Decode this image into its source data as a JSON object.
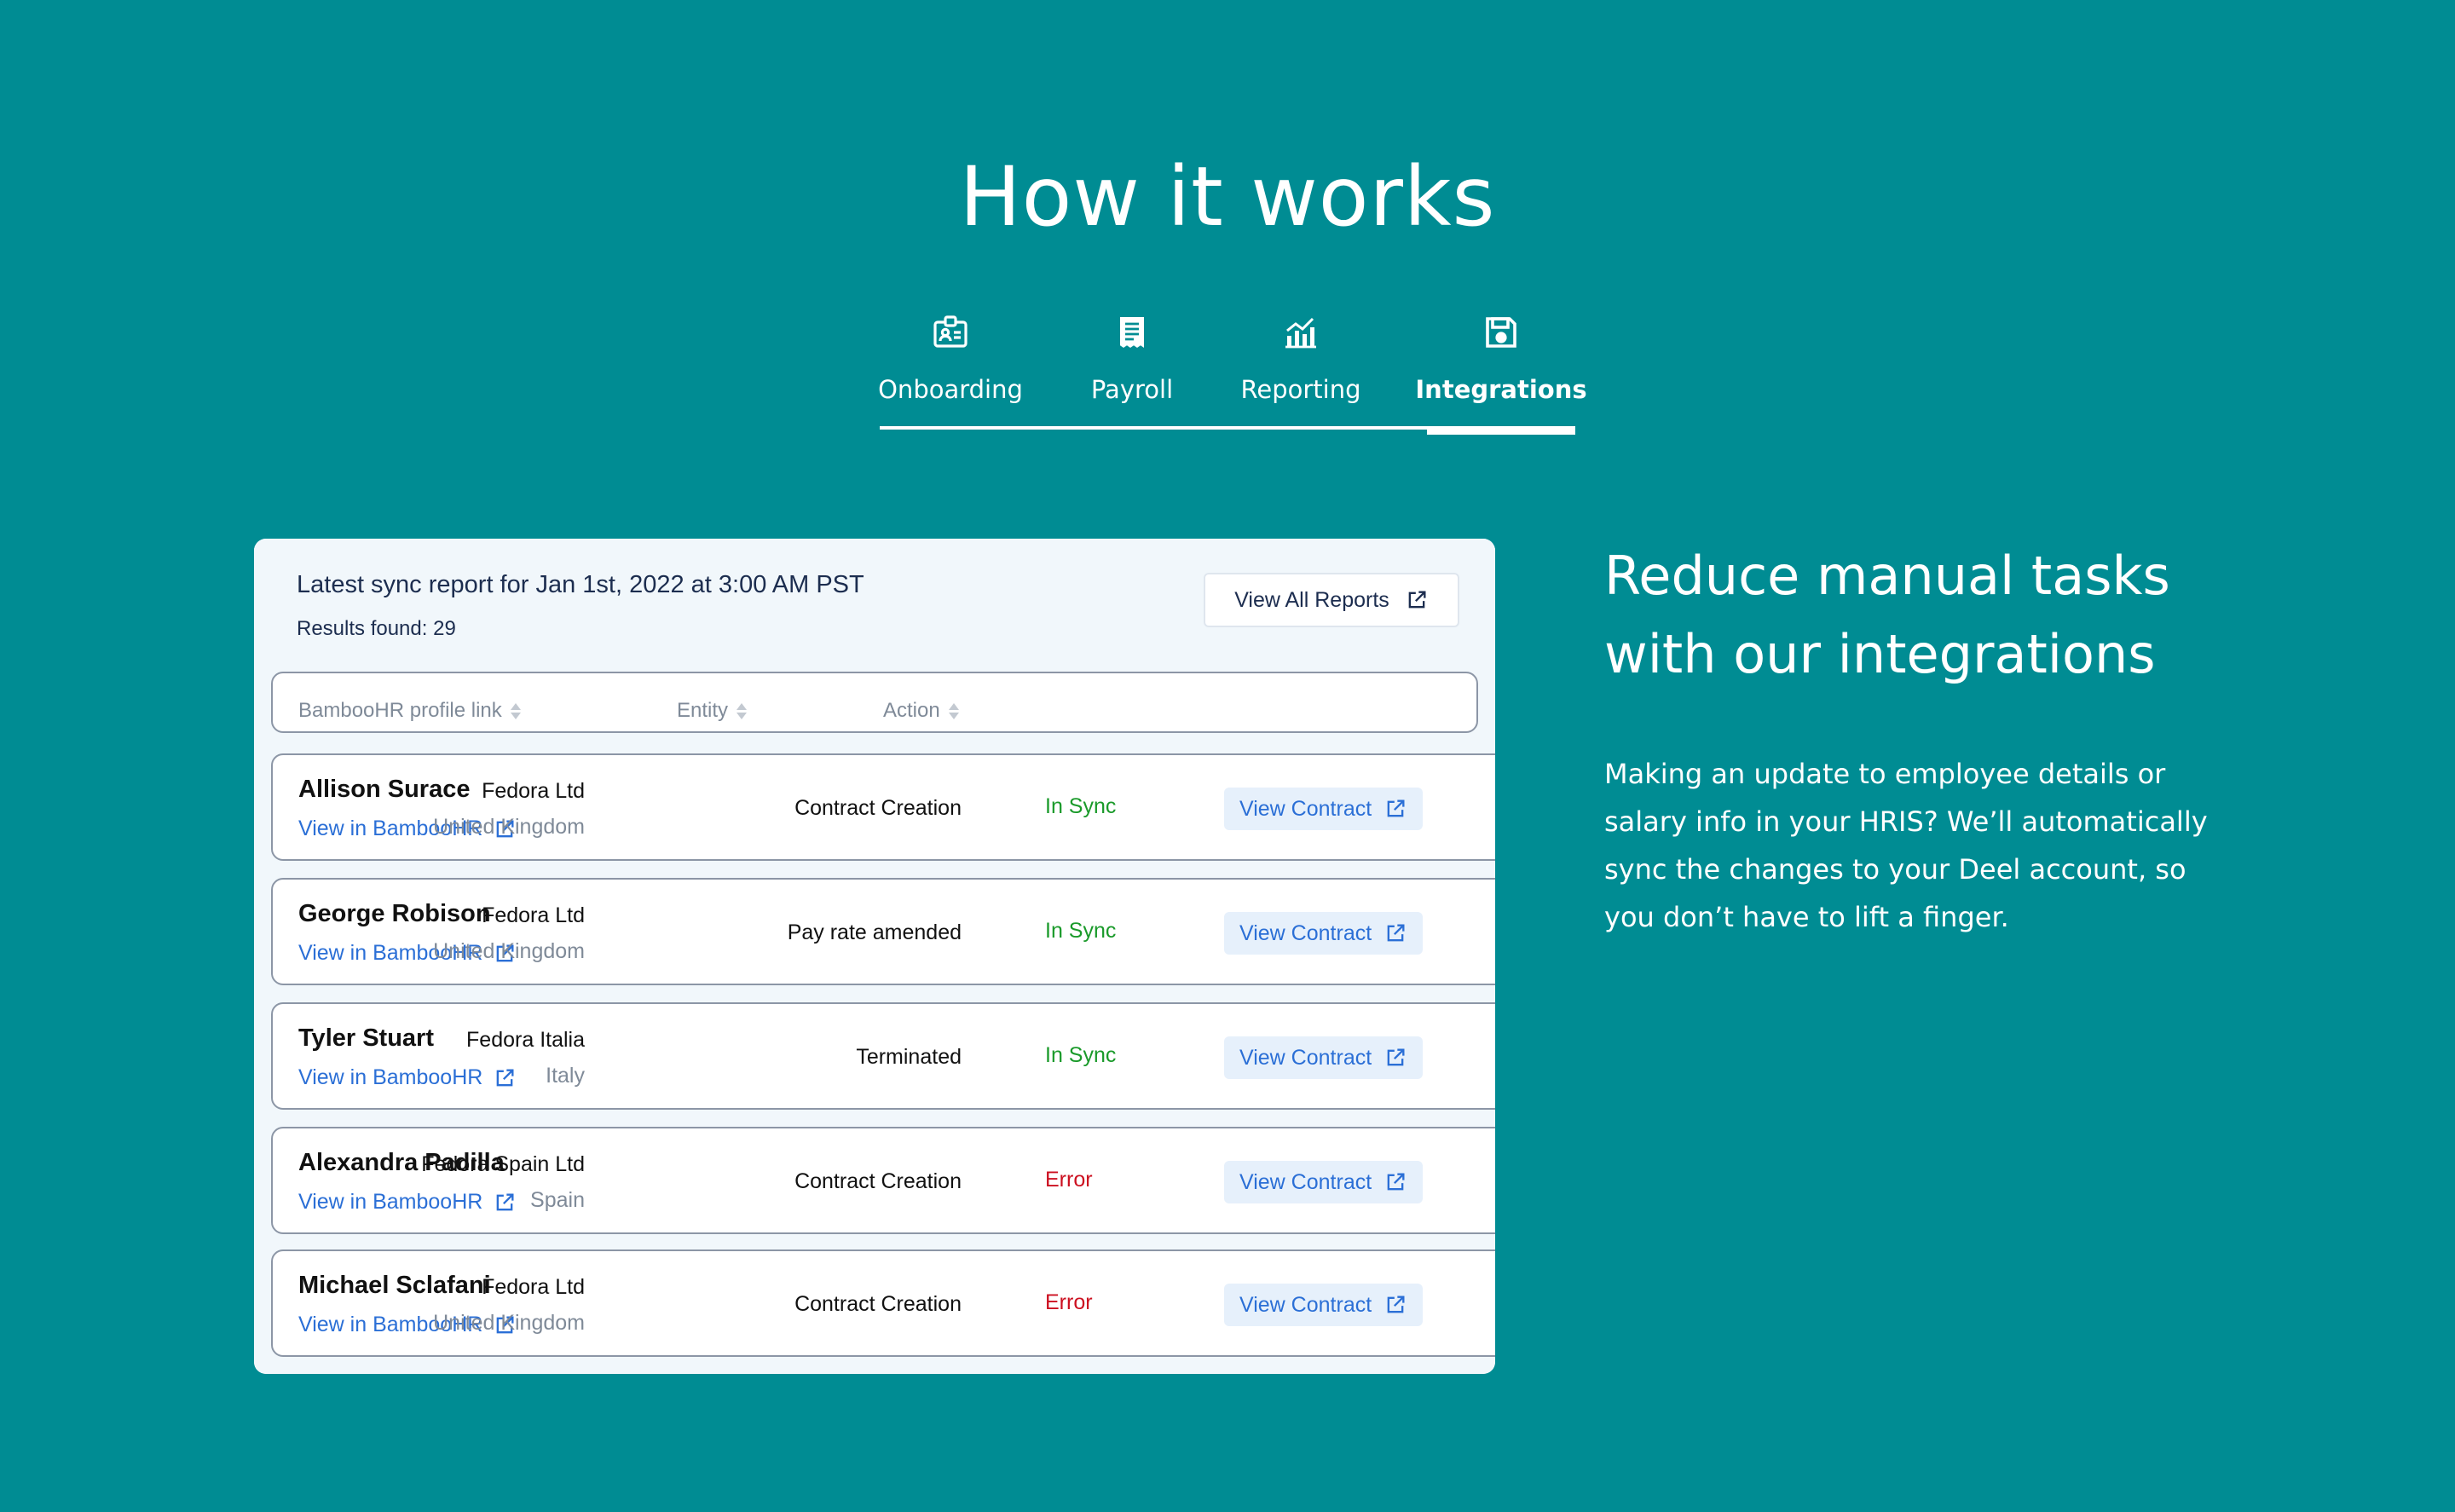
{
  "heading": "How it works",
  "tabs": [
    {
      "label": "Onboarding",
      "icon": "id-badge-icon"
    },
    {
      "label": "Payroll",
      "icon": "receipt-icon"
    },
    {
      "label": "Reporting",
      "icon": "bar-chart-icon"
    },
    {
      "label": "Integrations",
      "icon": "floppy-disk-icon",
      "active": true
    }
  ],
  "report": {
    "title": "Latest sync report for Jan 1st, 2022 at 3:00 AM PST",
    "results": "Results found: 29",
    "view_all_label": "View All Reports",
    "columns": [
      "BambooHR profile link",
      "Entity",
      "Action"
    ],
    "rows": [
      {
        "name": "Allison Surace",
        "link": "View in BambooHR",
        "entity": "Fedora Ltd",
        "country": "United Kingdom",
        "action": "Contract Creation",
        "status": "In Sync",
        "button": "View Contract"
      },
      {
        "name": "George Robison",
        "link": "View in BambooHR",
        "entity": "Fedora Ltd",
        "country": "United Kingdom",
        "action": "Pay rate amended",
        "status": "In Sync",
        "button": "View Contract"
      },
      {
        "name": "Tyler Stuart",
        "link": "View in BambooHR",
        "entity": "Fedora Italia",
        "country": "Italy",
        "action": "Terminated",
        "status": "In Sync",
        "button": "View Contract"
      },
      {
        "name": "Alexandra Padilla",
        "link": "View in BambooHR",
        "entity": "Fedora Spain Ltd",
        "country": "Spain",
        "action": "Contract Creation",
        "status": "Error",
        "button": "View Contract"
      },
      {
        "name": "Michael Sclafani",
        "link": "View in BambooHR",
        "entity": "Fedora Ltd",
        "country": "United Kingdom",
        "action": "Contract Creation",
        "status": "Error",
        "button": "View Contract"
      }
    ]
  },
  "side": {
    "title": "Reduce manual tasks with our integrations",
    "text": "Making an update to employee details or salary info in your HRIS? We’ll automatically sync the changes to your Deel account, so you don’t have to lift a finger."
  },
  "colors": {
    "background": "#008c93",
    "link": "#2b6fd6",
    "in_sync": "#1a9a2a",
    "error": "#cc1020"
  }
}
